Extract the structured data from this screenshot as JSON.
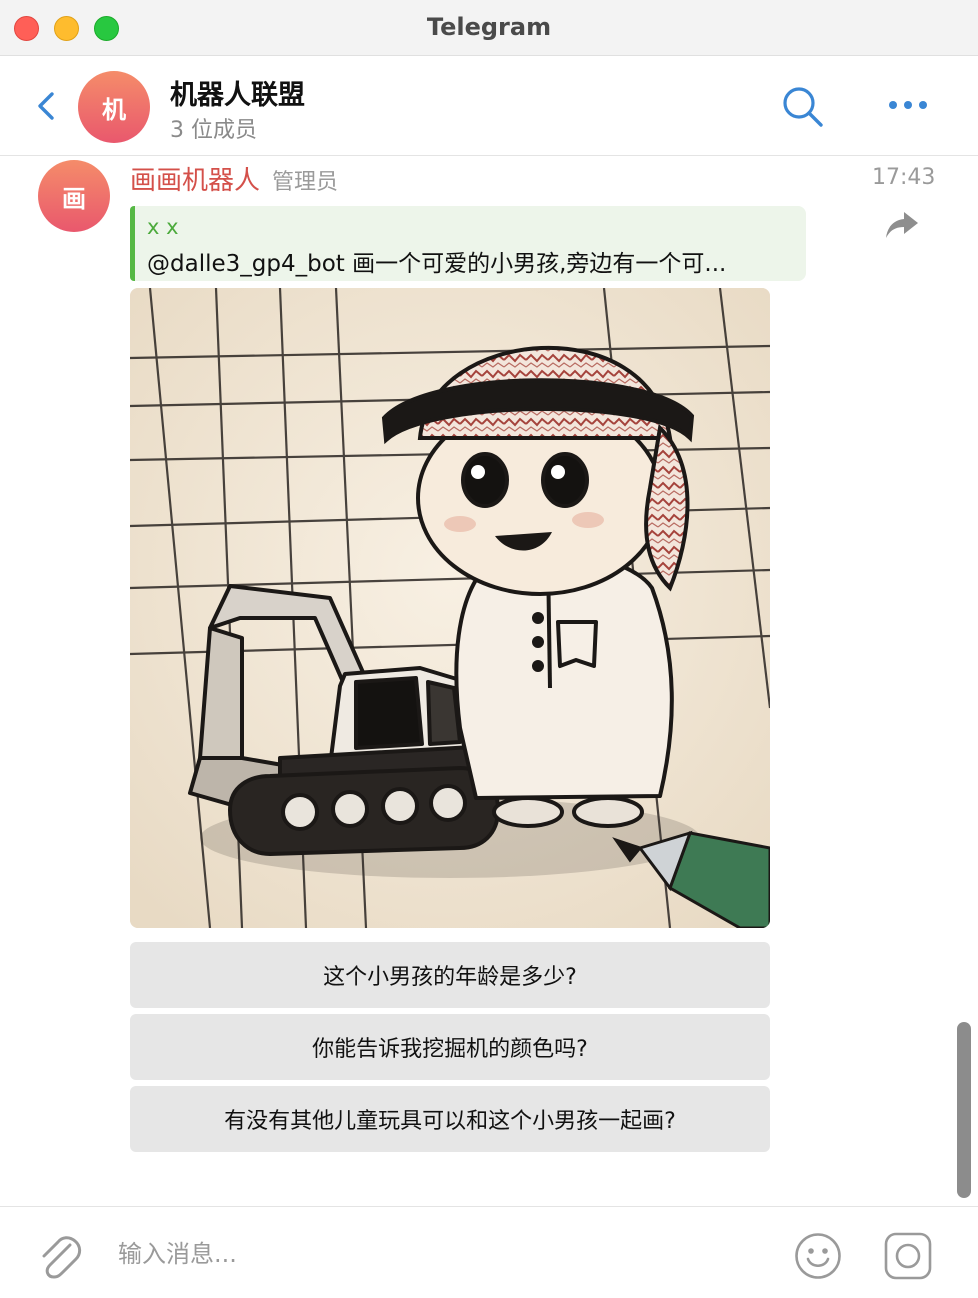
{
  "window": {
    "title": "Telegram"
  },
  "header": {
    "avatar_letter": "机",
    "group_name": "机器人联盟",
    "member_count": "3 位成员",
    "icons": {
      "back": "chevron-left-icon",
      "search": "search-icon",
      "more": "more-dots-icon"
    }
  },
  "message": {
    "avatar_letter": "画",
    "sender": "画画机器人",
    "role": "管理员",
    "time": "17:43",
    "reply": {
      "author": "x x",
      "text": "@dalle3_gp4_bot 画一个可爱的小男孩,旁边有一个可..."
    },
    "photo": {
      "subject": "sketch of a boy in a patterned head wrap standing next to a toy excavator with a pen"
    },
    "inline_buttons": [
      {
        "label": "这个小男孩的年龄是多少?"
      },
      {
        "label": "你能告诉我挖掘机的颜色吗?"
      },
      {
        "label": "有没有其他儿童玩具可以和这个小男孩一起画?"
      }
    ],
    "forward_icon": "forward-arrow-icon"
  },
  "composer": {
    "placeholder": "输入消息...",
    "icons": {
      "attach": "paperclip-icon",
      "emoji": "smiley-icon",
      "camera": "camera-icon"
    }
  },
  "colors": {
    "accent": "#3a86d4",
    "sender_name": "#d4504a",
    "reply_author": "#4caa3c",
    "reply_bar": "#56b845",
    "avatar_gradient_top": "#f58c6a",
    "avatar_gradient_bottom": "#e9586d"
  }
}
